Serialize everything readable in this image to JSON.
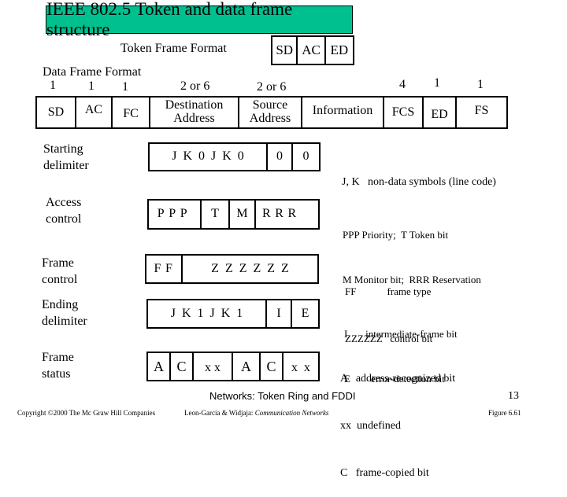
{
  "title": "IEEE 802.5 Token and data frame structure",
  "colors": {
    "banner": "#00c090",
    "border": "#000000",
    "text": "#000000"
  },
  "token_frame": {
    "label": "Token Frame Format",
    "fields": [
      "SD",
      "AC",
      "ED"
    ]
  },
  "data_frame": {
    "label": "Data Frame Format",
    "fields": [
      {
        "size": "1",
        "name": "SD"
      },
      {
        "size": "1",
        "name": "AC"
      },
      {
        "size": "1",
        "name": "FC"
      },
      {
        "size": "2 or 6",
        "name_line1": "Destination",
        "name_line2": "Address"
      },
      {
        "size": "2 or 6",
        "name_line1": "Source",
        "name_line2": "Address"
      },
      {
        "size": "",
        "name": "Information"
      },
      {
        "size": "4",
        "name": "FCS"
      },
      {
        "size": "1",
        "name": "ED"
      },
      {
        "size": "1",
        "name": "FS"
      }
    ]
  },
  "details": [
    {
      "label_line1": "Starting",
      "label_line2": "delimiter",
      "cells": [
        "J  K  0  J  K  0",
        "0",
        "0"
      ],
      "note_lines": [
        "J, K   non-data symbols (line code)"
      ]
    },
    {
      "label_line1": "Access",
      "label_line2": "control",
      "cells": [
        "PPP",
        "T",
        "M",
        "RRR"
      ],
      "note_lines": [
        "PPP Priority;  T Token bit",
        "M Monitor bit;  RRR Reservation"
      ]
    },
    {
      "label_line1": "Frame",
      "label_line2": "control",
      "cells": [
        "FF",
        "Z  Z  Z  Z  Z  Z"
      ],
      "note_lines": [
        "FF            frame type",
        "ZZZZZZ   control bit"
      ]
    },
    {
      "label_line1": "Ending",
      "label_line2": "delimiter",
      "cells": [
        "J  K  1  J  K  1",
        "I",
        "E"
      ],
      "note_lines": [
        "I       intermediate-frame bit",
        "E        error-detection bit"
      ]
    },
    {
      "label_line1": "Frame",
      "label_line2": "status",
      "cells": [
        "A",
        "C",
        "x x",
        "A",
        "C",
        "x  x"
      ],
      "note_lines": [
        "A   address-recognized bit",
        "xx  undefined",
        "C   frame-copied bit"
      ]
    }
  ],
  "footer": {
    "chapter": "Networks:  Token Ring and FDDI",
    "page": "13",
    "copyright": "Copyright ©2000 The Mc Graw Hill Companies",
    "authors": "Leon-Garcia & Widjaja:",
    "book": "Communication Networks",
    "figure": "Figure 6.61"
  }
}
